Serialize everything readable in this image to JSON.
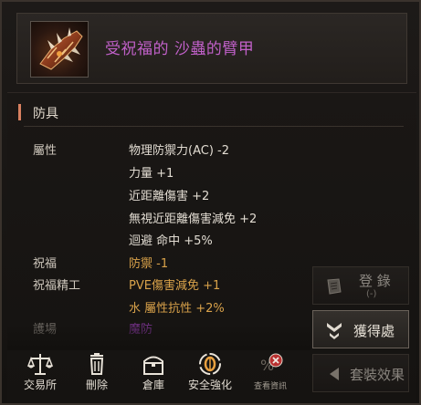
{
  "item": {
    "name": "受祝福的 沙蟲的臂甲",
    "icon": "bracer-item-icon"
  },
  "section": {
    "title": "防具"
  },
  "stats": [
    {
      "label": "屬性",
      "values": [
        "物理防禦力(AC) -2",
        "力量 +1",
        "近距離傷害 +2",
        "無視近距離傷害減免 +2",
        "迴避 命中 +5%"
      ]
    },
    {
      "label": "祝福",
      "values": [
        "防禦 -1"
      ]
    },
    {
      "label": "祝福精工",
      "values": [
        "PVE傷害減免 +1",
        "水 屬性抗性 +2%"
      ]
    },
    {
      "label": "護場",
      "values": [
        "魔防"
      ]
    }
  ],
  "buttons": {
    "register": {
      "label": "登 錄",
      "sub": "(-)",
      "icon": "scroll-icon"
    },
    "source": {
      "label": "獲得處",
      "icon": "chevron-arrow-icon"
    },
    "set_effect": {
      "label": "套裝效果",
      "icon": "triangle-left-icon"
    }
  },
  "toolbar": [
    {
      "label": "交易所",
      "icon": "scales-icon"
    },
    {
      "label": "刪除",
      "icon": "trash-icon"
    },
    {
      "label": "倉庫",
      "icon": "chest-icon"
    },
    {
      "label": "安全強化",
      "icon": "safe-enhance-icon"
    },
    {
      "label": "查看資訊",
      "icon": "percent-disabled-icon"
    }
  ],
  "colors": {
    "item_name": "#c060c8",
    "gold_text": "#d9a24a",
    "section_accent": "#d88060",
    "background": "#1a1715"
  }
}
